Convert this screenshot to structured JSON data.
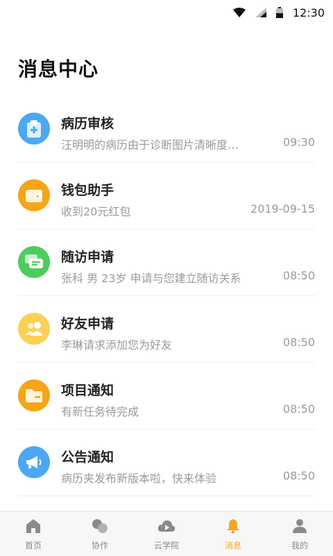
{
  "status": {
    "time": "12:30"
  },
  "header": {
    "title": "消息中心"
  },
  "messages": [
    {
      "icon": "medical-record-icon",
      "title": "病历审核",
      "preview": "汪明明的病历由于诊断图片清晰度…",
      "time": "09:30",
      "color": "#4aa8f5"
    },
    {
      "icon": "wallet-icon",
      "title": "钱包助手",
      "preview": "收到20元红包",
      "time": "2019-09-15",
      "color": "#f7a416"
    },
    {
      "icon": "chat-bubbles-icon",
      "title": "随访申请",
      "preview": "张科 男 23岁 申请与您建立随访关系",
      "time": "08:50",
      "color": "#4ccd5e"
    },
    {
      "icon": "users-icon",
      "title": "好友申请",
      "preview": "李琳请求添加您为好友",
      "time": "08:50",
      "color": "#fad156"
    },
    {
      "icon": "folder-icon",
      "title": "项目通知",
      "preview": "有新任务待完成",
      "time": "08:50",
      "color": "#f7a416"
    },
    {
      "icon": "megaphone-icon",
      "title": "公告通知",
      "preview": "病历夹发布新版本啦，快来体验",
      "time": "08:50",
      "color": "#4aa8f5"
    }
  ],
  "tabs": [
    {
      "icon": "home-icon",
      "label": "首页",
      "active": false
    },
    {
      "icon": "collaborate-icon",
      "label": "协作",
      "active": false
    },
    {
      "icon": "cloud-play-icon",
      "label": "云学院",
      "active": false
    },
    {
      "icon": "bell-icon",
      "label": "消息",
      "active": true
    },
    {
      "icon": "person-icon",
      "label": "我的",
      "active": false
    }
  ],
  "colors": {
    "accent": "#f5a623",
    "inactive": "#8a8a8a"
  }
}
